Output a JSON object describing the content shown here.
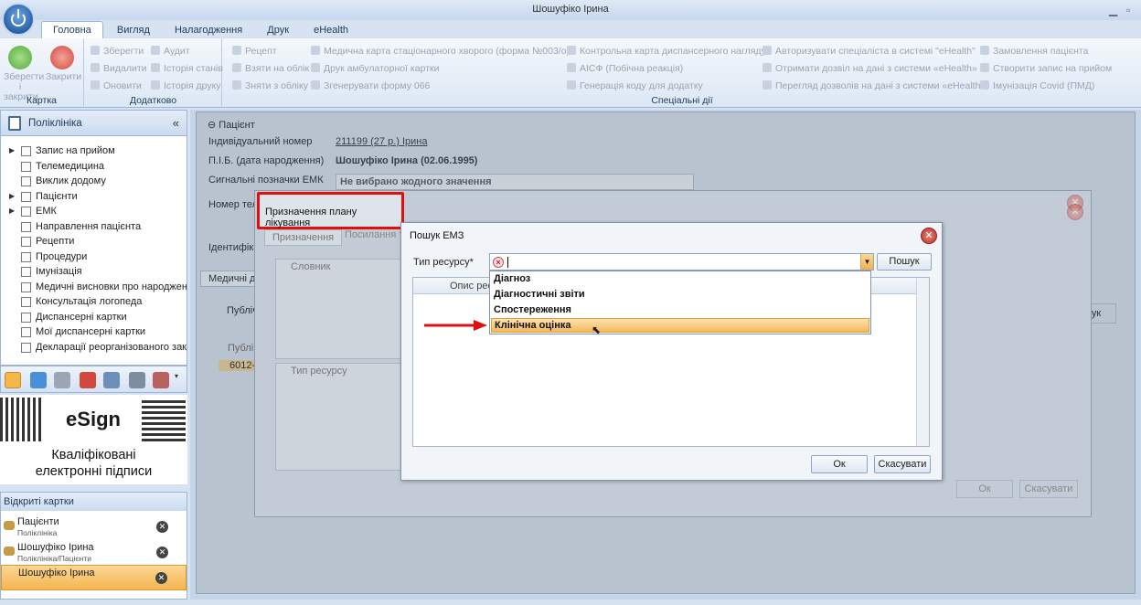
{
  "window": {
    "title": "Шошуфіко Ірина"
  },
  "ribbon": {
    "tabs": [
      "Головна",
      "Вигляд",
      "Налагодження",
      "Друк",
      "eHealth"
    ],
    "active_tab": "Головна",
    "groups": {
      "card": {
        "caption": "Картка",
        "save_close": "Зберегти і закрити",
        "close": "Закрити"
      },
      "extra": {
        "caption": "Додатково",
        "items": [
          "Зберегти",
          "Аудит",
          "Видалити",
          "Історія станів",
          "Оновити",
          "Історія друку"
        ]
      },
      "special": {
        "caption": "Спеціальні дії",
        "col1": [
          "Рецепт",
          "Взяти на облік",
          "Зняти з обліку"
        ],
        "col2": [
          "Медична карта стаціонарного хворого (форма №003/о)",
          "Друк амбулаторної картки",
          "Згенерувати форму 066"
        ],
        "col3": [
          "Контрольна карта диспансерного нагляду",
          "АІСФ (Побічна реакція)",
          "Генерація коду для додатку"
        ],
        "col4": [
          "Авторизувати спеціаліста в системі \"eHealth\"",
          "Отримати дозвіл на дані з системи «eHealth»",
          "Перегляд дозволів на дані з системи «eHealth»"
        ],
        "col5": [
          "Замовлення пацієнта",
          "Створити запис на прийом",
          "Імунізація Covid (ПМД)"
        ]
      }
    }
  },
  "nav": {
    "title": "Поліклініка",
    "items": [
      "Запис на прийом",
      "Телемедицина",
      "Виклик додому",
      "Пацієнти",
      "ЕМК",
      "Направлення пацієнта",
      "Рецепти",
      "Процедури",
      "Імунізація",
      "Медичні висновки про народженн",
      "Консультація логопеда",
      "Диспансерні картки",
      "Мої диспансерні картки",
      "Декларації реорганізованого закл"
    ]
  },
  "esign": {
    "logo": "eSign",
    "text_line1": "Кваліфіковані",
    "text_line2": "електронні підписи"
  },
  "open_cards": {
    "title": "Відкриті картки",
    "items": [
      {
        "name": "Пацієнти",
        "sub": "Поліклініка"
      },
      {
        "name": "Шошуфіко Ірина",
        "sub": "Поліклініка/Пацієнти"
      },
      {
        "name": "Шошуфіко Ірина",
        "sub": ""
      }
    ]
  },
  "patient": {
    "section": "Пацієнт",
    "id_label": "Індивідуальний номер",
    "id_value": "211199 (27 р.) Ірина",
    "name_label": "П.І.Б. (дата народження)",
    "name_value": "Шошуфіко Ірина (02.06.1995)",
    "signal_label": "Сигнальні позначки ЕМК",
    "signal_value": "Не вибрано жодного значення",
    "phone_label": "Номер теле",
    "ident_label": "Ідентифікат",
    "tab_med": "Медичні до",
    "public_label": "Публіч",
    "public_col": "Публі",
    "row_val": "6012-6",
    "search_btn": "шук"
  },
  "plan_dialog": {
    "title": "Призначення плану лікування",
    "tabs": [
      "Призначення",
      "Посилання т"
    ],
    "dict_col": "Словник",
    "res_col": "Тип ресурсу",
    "ok": "Ок",
    "cancel": "Скасувати"
  },
  "search_dialog": {
    "title": "Пошук ЕМЗ",
    "type_label": "Тип ресурсу*",
    "search_btn": "Пошук",
    "col_desc": "Опис рес",
    "ok": "Ок",
    "cancel": "Скасувати",
    "options": [
      "Діагноз",
      "Діагностичні звіти",
      "Спостереження",
      "Клінічна оцінка"
    ],
    "highlighted": "Клінічна оцінка"
  },
  "colors": {
    "highlight": "#f6b85a",
    "red_box": "#e01010",
    "arrow": "#e01010"
  }
}
